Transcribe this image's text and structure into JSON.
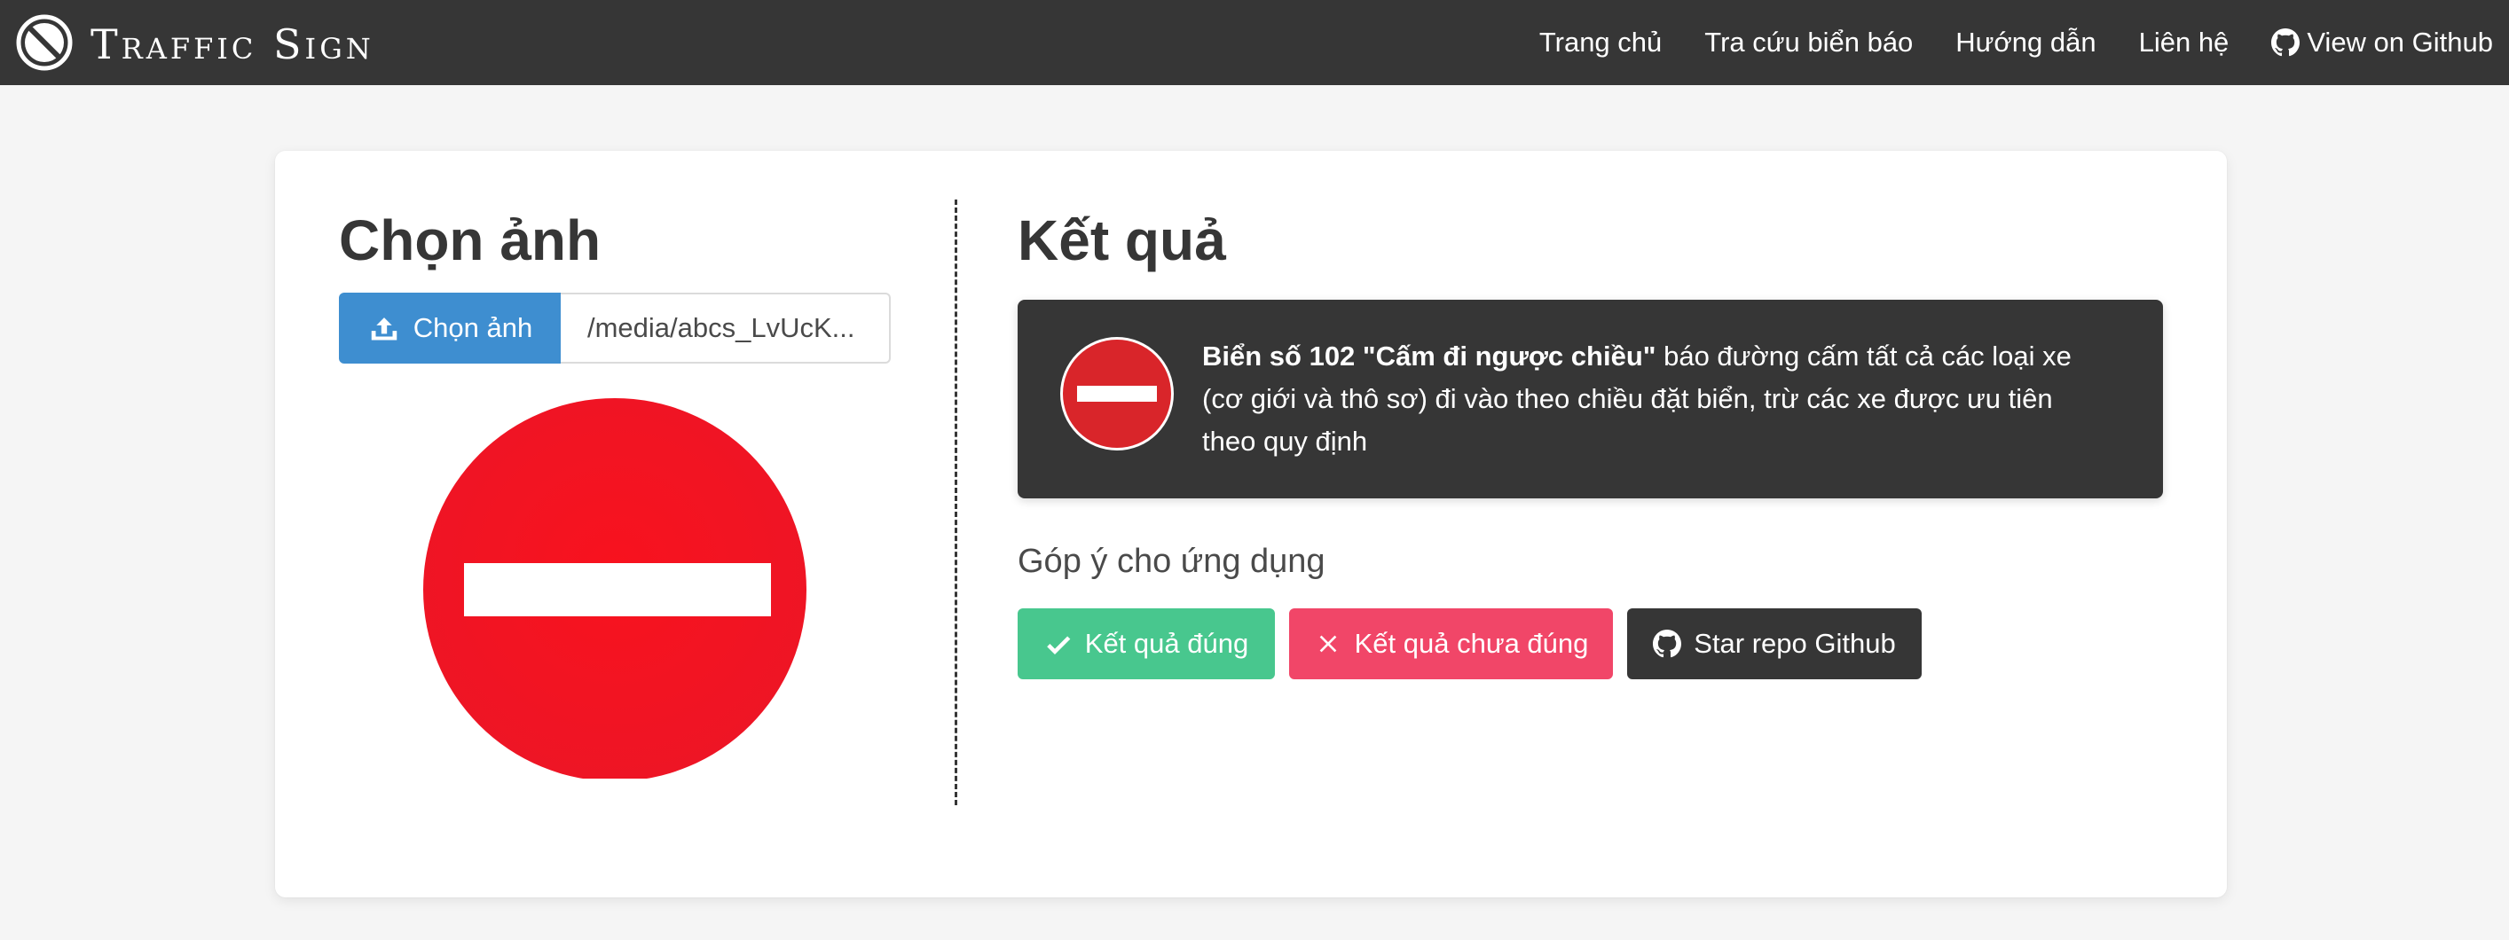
{
  "brand": {
    "title": "Traffic Sign",
    "logo_icon": "no-entry-circle-icon"
  },
  "nav": {
    "items": [
      {
        "label": "Trang chủ"
      },
      {
        "label": "Tra cứu biển báo"
      },
      {
        "label": "Hướng dẫn"
      },
      {
        "label": "Liên hệ"
      },
      {
        "label": "View on Github",
        "icon": "github-icon"
      }
    ]
  },
  "upload": {
    "title": "Chọn ảnh",
    "button_label": "Chọn ảnh",
    "button_icon": "upload-icon",
    "file_name": "/media/abcs_LvUcK..."
  },
  "result": {
    "title": "Kết quả",
    "sign_name": "Biển số 102 \"Cấm đi ngược chiều\"",
    "description": " báo đường cấm tất cả các loại xe (cơ giới và thô sơ) đi vào theo chiều đặt biển, trừ các xe được ưu tiên theo quy định",
    "sign_icon": "no-entry-sign-icon"
  },
  "feedback": {
    "title": "Góp ý cho ứng dụng",
    "correct_label": "Kết quả đúng",
    "incorrect_label": "Kết quả chưa đúng",
    "star_label": "Star repo Github"
  },
  "colors": {
    "navbar": "#363636",
    "primary": "#3e8ed0",
    "success": "#48c78e",
    "danger": "#f14668",
    "dark": "#363636",
    "sign_red": "#f2121f"
  }
}
